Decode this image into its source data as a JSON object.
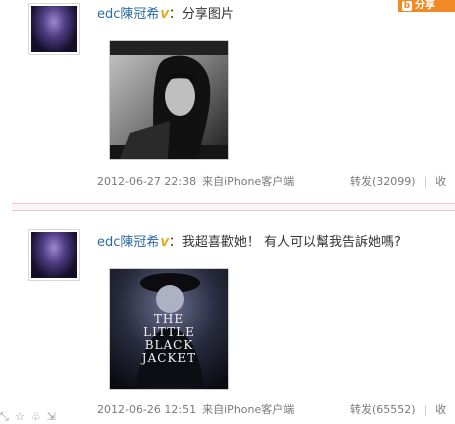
{
  "share_tag": {
    "icon": "b",
    "label": "分享"
  },
  "posts": [
    {
      "user": "edc陳冠希",
      "verified_mark": "V",
      "text": "：分享图片",
      "timestamp": "2012-06-27 22:38",
      "source": "来自iPhone客户端",
      "repost_label": "转发(32099)",
      "comment_label": "收"
    },
    {
      "user": "edc陳冠希",
      "verified_mark": "V",
      "text": "：我超喜歡她！ 有人可以幫我告訴她嗎?",
      "timestamp": "2012-06-26 12:51",
      "source": "来自iPhone客户端",
      "repost_label": "转发(65552)",
      "comment_label": "收",
      "image_text": [
        "THE",
        "LITTLE",
        "BLACK",
        "JACKET"
      ]
    }
  ],
  "colors": {
    "link": "#2b6aa5",
    "verified": "#e7a40c",
    "accent": "#f08a24",
    "divider": "#f3c4cf"
  }
}
